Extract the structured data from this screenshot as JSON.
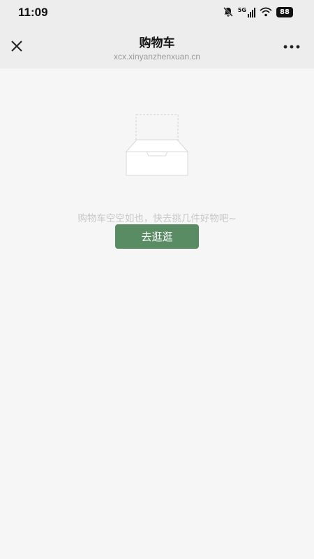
{
  "status_bar": {
    "time": "11:09",
    "icons": [
      "bell-muted-icon",
      "signal-5g-icon",
      "wifi-icon",
      "battery-icon"
    ],
    "network": "5G",
    "battery": "88"
  },
  "header": {
    "title": "购物车",
    "url": "xcx.xinyanzhenxuan.cn",
    "close_icon": "close-icon",
    "more_icon": "more-icon"
  },
  "empty_cart": {
    "illustration": "empty-box-icon",
    "message": "购物车空空如也，快去挑几件好物吧~",
    "button_label": "去逛逛",
    "button_color": "#5a8c64"
  }
}
